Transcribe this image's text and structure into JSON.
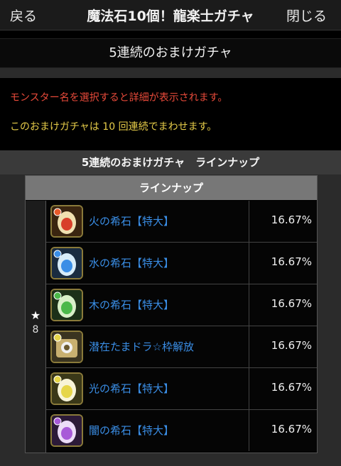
{
  "topbar": {
    "back_label": "戻る",
    "title": "魔法石10個！龍楽士ガチャ",
    "close_label": "閉じる"
  },
  "subtitle": "5連続のおまけガチャ",
  "notice": {
    "select_hint": "モンスター名を選択すると詳細が表示されます。",
    "rolls_info": "このおまけガチャは 10 回連続でまわせます。"
  },
  "lineup_section_title": "5連続のおまけガチャ　ラインナップ",
  "lineup": {
    "header": "ラインナップ",
    "rarity_star": "★",
    "rarity_value": "8",
    "items": [
      {
        "name": "火の希石【特大】",
        "rate": "16.67%",
        "icon": "fire-egg-icon",
        "color": "#d8402a"
      },
      {
        "name": "水の希石【特大】",
        "rate": "16.67%",
        "icon": "water-egg-icon",
        "color": "#3a8ee6"
      },
      {
        "name": "木の希石【特大】",
        "rate": "16.67%",
        "icon": "wood-egg-icon",
        "color": "#4bb84a"
      },
      {
        "name": "潜在たまドラ☆枠解放",
        "rate": "16.67%",
        "icon": "tamadra-icon",
        "color": "#c8b070"
      },
      {
        "name": "光の希石【特大】",
        "rate": "16.67%",
        "icon": "light-egg-icon",
        "color": "#e6d64a"
      },
      {
        "name": "闇の希石【特大】",
        "rate": "16.67%",
        "icon": "dark-egg-icon",
        "color": "#a85ad8"
      }
    ]
  },
  "colors": {
    "link": "#3a8ee6",
    "notice_red": "#e84a3a",
    "notice_yellow": "#e6cc49"
  }
}
